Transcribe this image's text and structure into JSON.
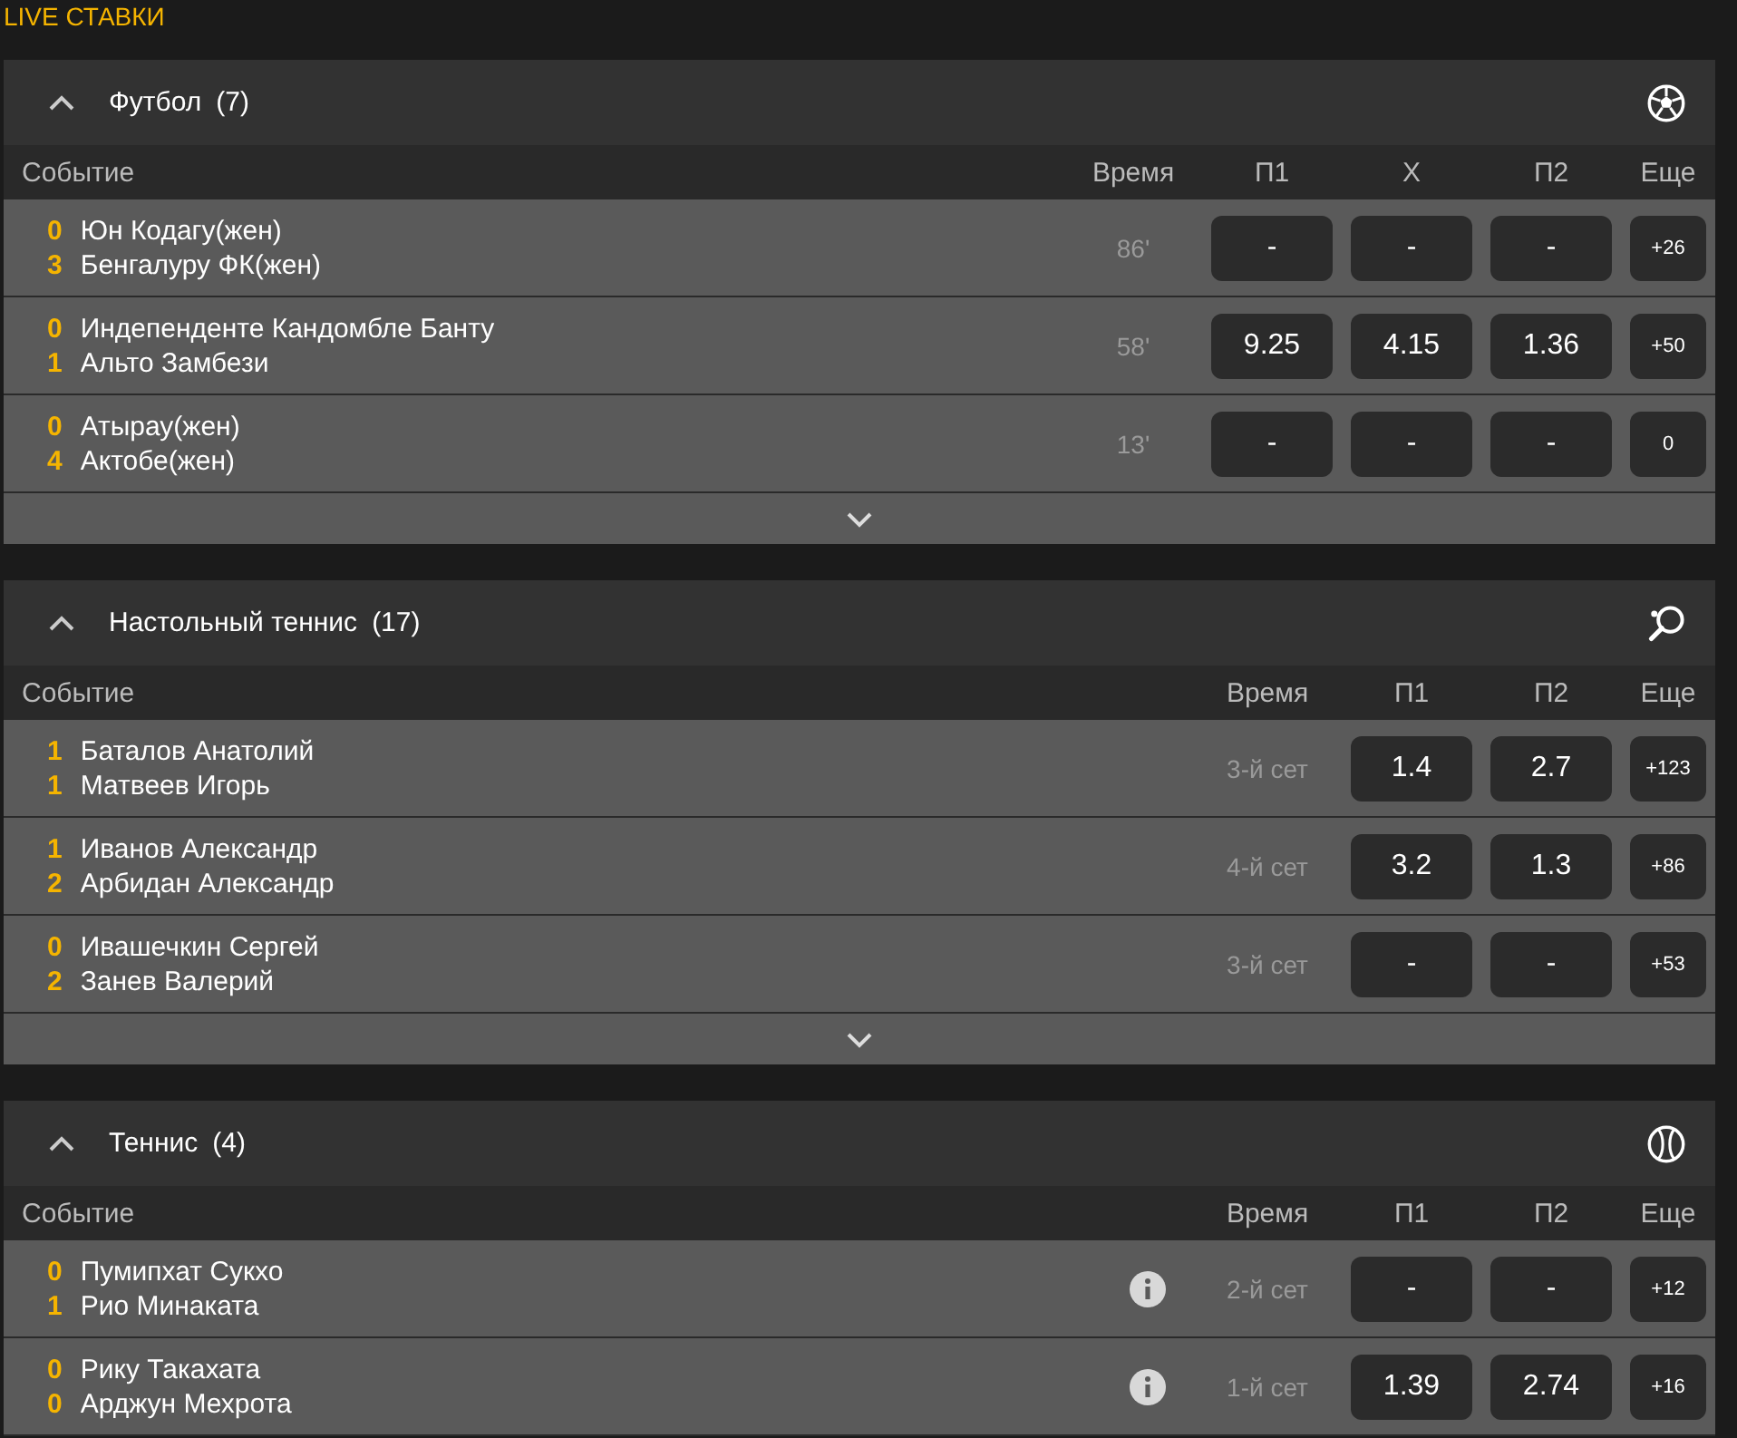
{
  "title": "LIVE СТАВКИ",
  "sections": [
    {
      "kind": "football",
      "name": "Футбол",
      "count": "(7)",
      "columns": [
        "Событие",
        "Время",
        "П1",
        "Х",
        "П2",
        "Еще"
      ],
      "rows": [
        {
          "scores": [
            "0",
            "3"
          ],
          "teams": [
            "Юн Кодагу(жен)",
            "Бенгалуру ФК(жен)"
          ],
          "info": false,
          "time": "86'",
          "odds": [
            "-",
            "-",
            "-"
          ],
          "more": "+26"
        },
        {
          "scores": [
            "0",
            "1"
          ],
          "teams": [
            "Индепенденте Кандомбле Банту",
            "Альто Замбези"
          ],
          "info": false,
          "time": "58'",
          "odds": [
            "9.25",
            "4.15",
            "1.36"
          ],
          "more": "+50"
        },
        {
          "scores": [
            "0",
            "4"
          ],
          "teams": [
            "Атырау(жен)",
            "Актобе(жен)"
          ],
          "info": false,
          "time": "13'",
          "odds": [
            "-",
            "-",
            "-"
          ],
          "more": "0"
        }
      ],
      "footer": true
    },
    {
      "kind": "table-tennis",
      "name": "Настольный теннис",
      "count": "(17)",
      "columns": [
        "Событие",
        "Время",
        "П1",
        "П2",
        "Еще"
      ],
      "rows": [
        {
          "scores": [
            "1",
            "1"
          ],
          "teams": [
            "Баталов Анатолий",
            "Матвеев Игорь"
          ],
          "info": false,
          "time": "3-й сет",
          "odds": [
            "1.4",
            "2.7"
          ],
          "more": "+123"
        },
        {
          "scores": [
            "1",
            "2"
          ],
          "teams": [
            "Иванов Александр",
            "Арбидан Александр"
          ],
          "info": false,
          "time": "4-й сет",
          "odds": [
            "3.2",
            "1.3"
          ],
          "more": "+86"
        },
        {
          "scores": [
            "0",
            "2"
          ],
          "teams": [
            "Ивашечкин Сергей",
            "Занев Валерий"
          ],
          "info": false,
          "time": "3-й сет",
          "odds": [
            "-",
            "-"
          ],
          "more": "+53"
        }
      ],
      "footer": true
    },
    {
      "kind": "tennis",
      "name": "Теннис",
      "count": "(4)",
      "columns": [
        "Событие",
        "Время",
        "П1",
        "П2",
        "Еще"
      ],
      "rows": [
        {
          "scores": [
            "0",
            "1"
          ],
          "teams": [
            "Пумипхат Сукхо",
            "Рио Минаката"
          ],
          "info": true,
          "time": "2-й сет",
          "odds": [
            "-",
            "-"
          ],
          "more": "+12"
        },
        {
          "scores": [
            "0",
            "0"
          ],
          "teams": [
            "Рику Такахата",
            "Арджун Мехрота"
          ],
          "info": true,
          "time": "1-й сет",
          "odds": [
            "1.39",
            "2.74"
          ],
          "more": "+16"
        }
      ],
      "footer": false
    }
  ]
}
